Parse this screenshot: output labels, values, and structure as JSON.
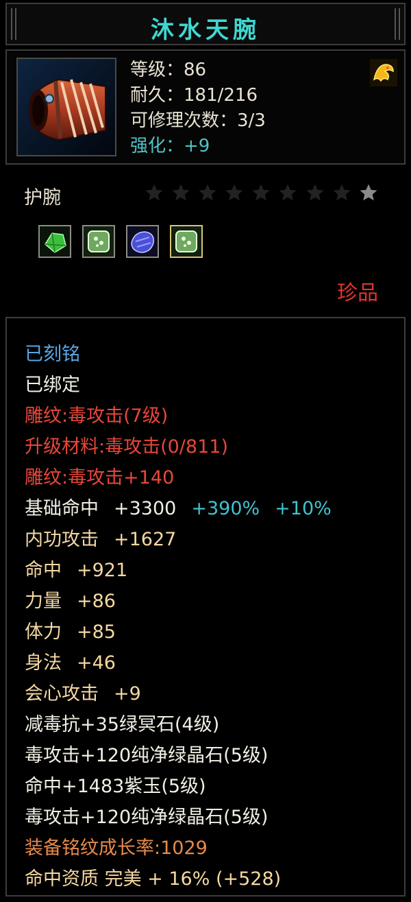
{
  "item": {
    "name": "沐水天腕",
    "level": "等级：86",
    "durability": "耐久：181/216",
    "repairs": "可修理次数：3/3",
    "enhance": "强化：+9",
    "type": "护腕",
    "rarity": "珍品",
    "stars_total": 9,
    "stars_filled": 1,
    "gems": [
      {
        "icon": "green-crystal-icon"
      },
      {
        "icon": "green-jade-icon"
      },
      {
        "icon": "purple-jade-icon"
      },
      {
        "icon": "green-jade-icon"
      }
    ]
  },
  "attrs": {
    "engraved": "已刻铭",
    "bound": "已绑定",
    "carving": "雕纹:毒攻击(7级)",
    "upgrade_mat": "升级材料:毒攻击(0/811)",
    "carving_bonus": "雕纹:毒攻击+140",
    "base_hit_label": "基础命中",
    "base_hit_value": "+3300",
    "base_hit_pct1": "+390%",
    "base_hit_pct2": "+10%",
    "inner_attack_label": "内功攻击",
    "inner_attack_value": "+1627",
    "hit_label": "命中",
    "hit_value": "+921",
    "str_label": "力量",
    "str_value": "+86",
    "con_label": "体力",
    "con_value": "+85",
    "agi_label": "身法",
    "agi_value": "+46",
    "crit_label": "会心攻击",
    "crit_value": "+9",
    "gem1": "减毒抗+35绿冥石(4级)",
    "gem2": "毒攻击+120纯净绿晶石(5级)",
    "gem3": "命中+1483紫玉(5级)",
    "gem4": "毒攻击+120纯净绿晶石(5级)",
    "growth": "装备铭纹成长率:1029",
    "quality": "命中资质  完美 + 16% (+528)"
  },
  "colors": {
    "title": "#3fd7d0",
    "engraved": "#5aa6e4",
    "red_text": "#e8473a",
    "stat_text": "#f5d8a2",
    "percent": "#3fc3d0",
    "growth": "#e88a4a",
    "rarity": "#e0352a"
  }
}
